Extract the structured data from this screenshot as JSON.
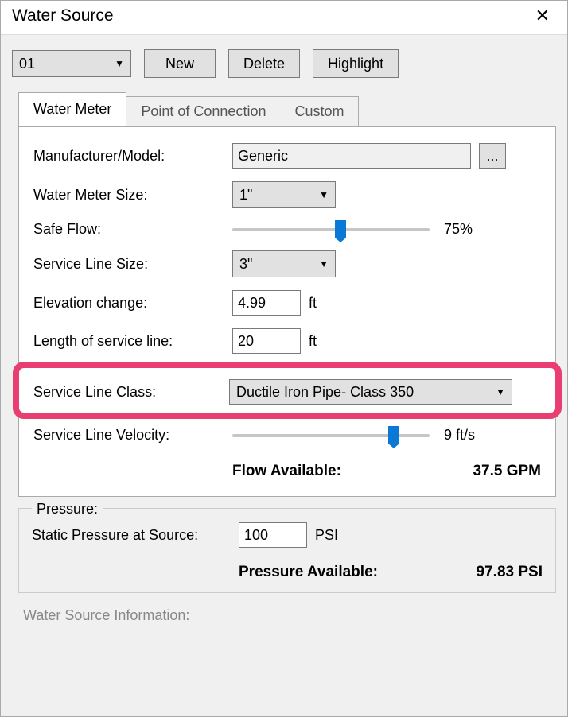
{
  "window": {
    "title": "Water Source"
  },
  "toolbar": {
    "id_select": "01",
    "new_label": "New",
    "delete_label": "Delete",
    "highlight_label": "Highlight"
  },
  "tabs": {
    "water_meter": "Water Meter",
    "poc": "Point of Connection",
    "custom": "Custom"
  },
  "form": {
    "manufacturer_label": "Manufacturer/Model:",
    "manufacturer_value": "Generic",
    "browse_label": "...",
    "meter_size_label": "Water Meter Size:",
    "meter_size_value": "1\"",
    "safe_flow_label": "Safe Flow:",
    "safe_flow_value": "75%",
    "safe_flow_pct": 55,
    "service_line_size_label": "Service Line Size:",
    "service_line_size_value": "3\"",
    "elevation_label": "Elevation change:",
    "elevation_value": "4.99",
    "elevation_unit": "ft",
    "length_label": "Length of service line:",
    "length_value": "20",
    "length_unit": "ft",
    "service_class_label": "Service Line Class:",
    "service_class_value": "Ductile Iron Pipe- Class 350",
    "velocity_label": "Service Line Velocity:",
    "velocity_value": "9 ft/s",
    "velocity_pct": 82,
    "flow_available_label": "Flow Available:",
    "flow_available_value": "37.5 GPM"
  },
  "pressure": {
    "legend": "Pressure:",
    "static_label": "Static Pressure at Source:",
    "static_value": "100",
    "static_unit": "PSI",
    "available_label": "Pressure Available:",
    "available_value": "97.83 PSI"
  },
  "info": {
    "legend": "Water Source Information:"
  }
}
